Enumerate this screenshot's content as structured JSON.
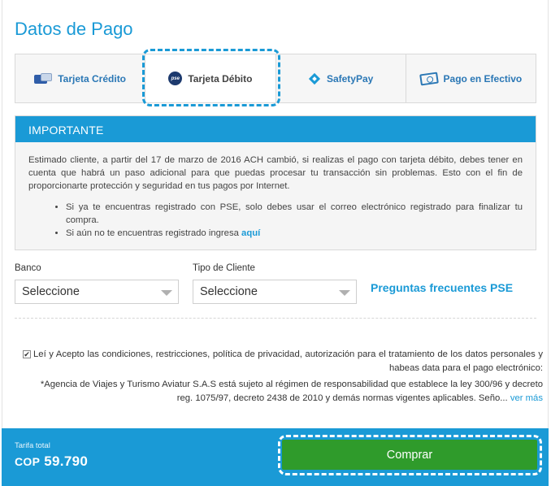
{
  "page": {
    "title": "Datos de Pago"
  },
  "tabs": [
    {
      "label": "Tarjeta Crédito",
      "icon": "credit-card-icon",
      "active": false
    },
    {
      "label": "Tarjeta Débito",
      "icon": "pse-icon",
      "active": true
    },
    {
      "label": "SafetyPay",
      "icon": "safetypay-icon",
      "active": false
    },
    {
      "label": "Pago en Efectivo",
      "icon": "cash-icon",
      "active": false
    }
  ],
  "notice": {
    "heading": "IMPORTANTE",
    "paragraph": "Estimado cliente, a partir del 17 de marzo de 2016 ACH cambió, si realizas el pago con tarjeta débito, debes tener en cuenta que habrá un paso adicional para que puedas procesar tu transacción sin problemas. Esto con el fin de proporcionarte protección y seguridad en tus pagos por Internet.",
    "bullet1": "Si ya te encuentras registrado con PSE, solo debes usar el correo electrónico registrado para finalizar tu compra.",
    "bullet2_text": "Si aún no te encuentras registrado ingresa",
    "bullet2_link": "aquí"
  },
  "form": {
    "bank_label": "Banco",
    "bank_value": "Seleccione",
    "client_type_label": "Tipo de Cliente",
    "client_type_value": "Seleccione",
    "faq_link": "Preguntas frecuentes PSE"
  },
  "terms": {
    "checked": true,
    "text": "Leí y Acepto las condiciones, restricciones, política de privacidad, autorización para el tratamiento de los datos personales y habeas data para el pago electrónico:",
    "agency_text": "*Agencia de Viajes y Turismo Aviatur S.A.S está sujeto al régimen de responsabilidad que establece la ley 300/96 y decreto reg. 1075/97, decreto 2438 de 2010 y demás normas vigentes aplicables. Seño...",
    "more_link": "ver más"
  },
  "footer": {
    "tarifa_label": "Tarifa total",
    "currency": "COP",
    "amount": "59.790",
    "buy_label": "Comprar"
  },
  "colors": {
    "accent": "#1a9ad6",
    "buy_button": "#2f9b2b"
  }
}
